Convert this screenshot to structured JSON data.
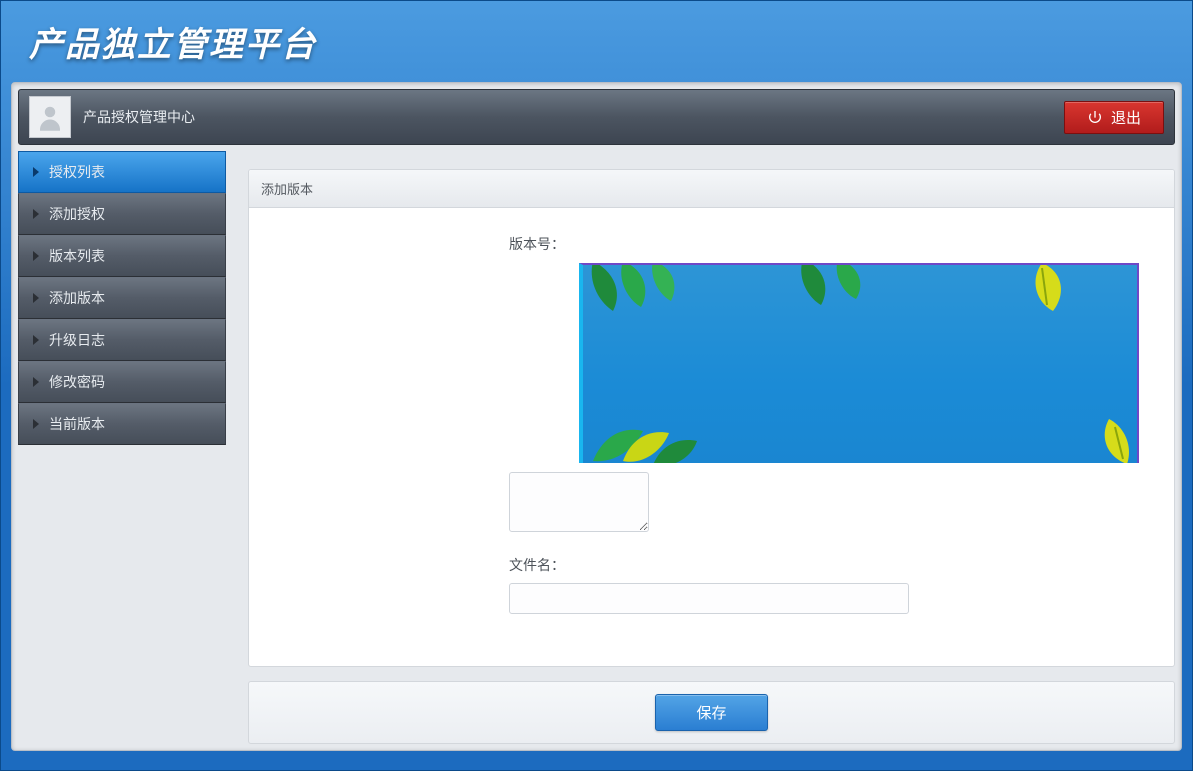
{
  "app_title": "产品独立管理平台",
  "topbar": {
    "title": "产品授权管理中心",
    "logout_label": "退出"
  },
  "sidebar": {
    "items": [
      {
        "label": "授权列表",
        "active": true
      },
      {
        "label": "添加授权",
        "active": false
      },
      {
        "label": "版本列表",
        "active": false
      },
      {
        "label": "添加版本",
        "active": false
      },
      {
        "label": "升级日志",
        "active": false
      },
      {
        "label": "修改密码",
        "active": false
      },
      {
        "label": "当前版本",
        "active": false
      }
    ]
  },
  "panel": {
    "header": "添加版本",
    "version_label": "版本号：",
    "filename_label": "文件名：",
    "version_value": "",
    "textarea_value": "",
    "filename_value": "",
    "filename_placeholder": ""
  },
  "footer": {
    "save_label": "保存"
  }
}
